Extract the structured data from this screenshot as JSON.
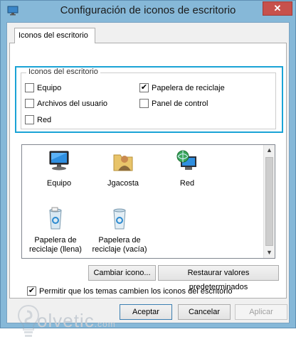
{
  "window": {
    "title": "Configuración de iconos de escritorio",
    "close_label": "✕"
  },
  "tab": {
    "label": "Iconos del escritorio"
  },
  "group": {
    "legend": "Iconos del escritorio",
    "checkboxes": [
      {
        "label": "Equipo",
        "checked": false
      },
      {
        "label": "Papelera de reciclaje",
        "checked": true
      },
      {
        "label": "Archivos del usuario",
        "checked": false
      },
      {
        "label": "Panel de control",
        "checked": false
      },
      {
        "label": "Red",
        "checked": false
      }
    ]
  },
  "icons": [
    {
      "label": "Equipo",
      "icon": "computer-icon"
    },
    {
      "label": "Jgacosta",
      "icon": "user-folder-icon"
    },
    {
      "label": "Red",
      "icon": "network-globe-icon"
    },
    {
      "label": "Papelera de reciclaje (llena)",
      "icon": "recycle-bin-full-icon"
    },
    {
      "label": "Papelera de reciclaje (vacía)",
      "icon": "recycle-bin-empty-icon"
    }
  ],
  "buttons": {
    "change_icon": "Cambiar icono...",
    "restore_defaults": "Restaurar valores predeterminados",
    "accept": "Aceptar",
    "cancel": "Cancelar",
    "apply": "Aplicar"
  },
  "themes_checkbox": {
    "label": "Permitir que los temas cambien los iconos del escritorio",
    "checked": true
  },
  "watermark": {
    "text": "olvetic",
    "suffix": ".com"
  },
  "colors": {
    "highlight": "#1aa3d6",
    "title_bar": "#86b8d8",
    "close": "#c7514c"
  }
}
